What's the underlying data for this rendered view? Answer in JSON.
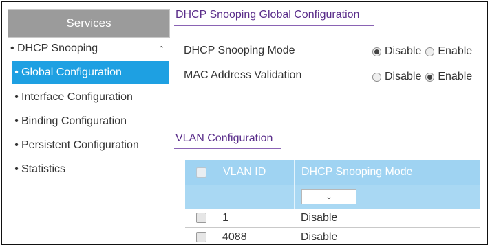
{
  "sidebar": {
    "header": "Services",
    "group": {
      "label": "DHCP Snooping",
      "bullet": "•",
      "chevron": "⌃"
    },
    "items": [
      {
        "label": "Global Configuration",
        "active": true
      },
      {
        "label": "Interface Configuration",
        "active": false
      },
      {
        "label": "Binding Configuration",
        "active": false
      },
      {
        "label": "Persistent Configuration",
        "active": false
      },
      {
        "label": "Statistics",
        "active": false
      }
    ]
  },
  "global_config": {
    "title": "DHCP Snooping Global Configuration",
    "mode": {
      "label": "DHCP Snooping Mode",
      "options": [
        "Disable",
        "Enable"
      ],
      "selected": "Disable"
    },
    "mac": {
      "label": "MAC Address Validation",
      "options": [
        "Disable",
        "Enable"
      ],
      "selected": "Enable"
    }
  },
  "vlan_config": {
    "title": "VLAN Configuration",
    "columns": [
      "VLAN ID",
      "DHCP Snooping Mode"
    ],
    "filter_select_value": "",
    "rows": [
      {
        "vlan_id": "1",
        "mode": "Disable"
      },
      {
        "vlan_id": "4088",
        "mode": "Disable"
      }
    ]
  },
  "colors": {
    "accent_purple": "#5a2d8a",
    "active_blue": "#1ea0e2",
    "table_header": "#9fd3f2",
    "sidebar_header": "#9b9b9b"
  }
}
